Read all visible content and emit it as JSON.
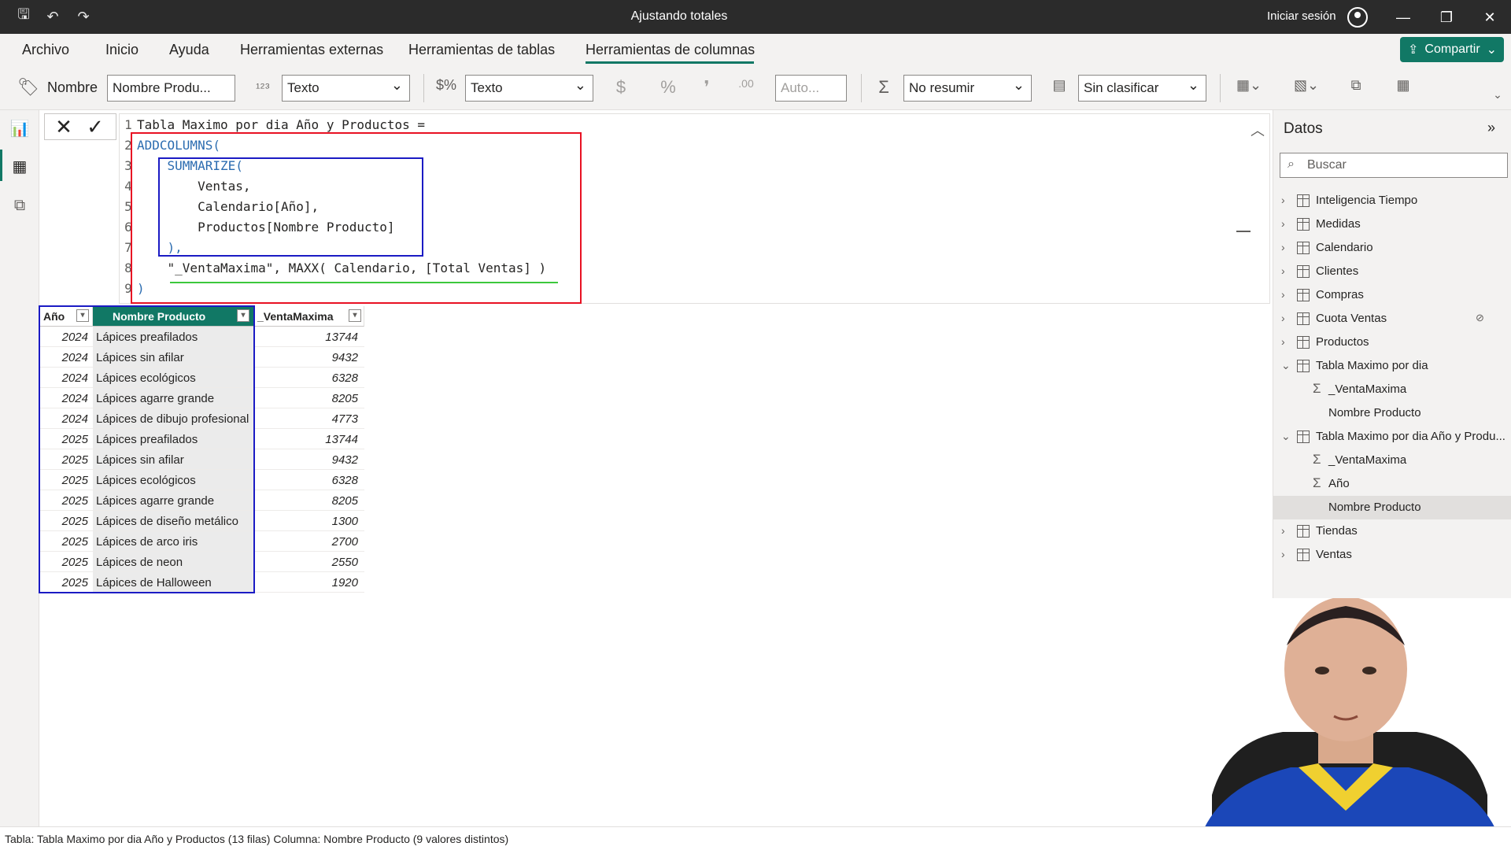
{
  "window": {
    "title": "Ajustando totales",
    "signin": "Iniciar sesión"
  },
  "menu": {
    "tabs": [
      "Archivo",
      "Inicio",
      "Ayuda",
      "Herramientas externas",
      "Herramientas de tablas",
      "Herramientas de columnas"
    ],
    "share": "Compartir"
  },
  "ribbon": {
    "name_label": "Nombre",
    "name_value": "Nombre Produ...",
    "datatype_value": "Texto",
    "format_value": "Texto",
    "decimals_placeholder": "Auto...",
    "summarize_value": "No resumir",
    "category_value": "Sin clasificar"
  },
  "formula": {
    "lines": [
      "Tabla Maximo por dia Año y Productos =",
      "ADDCOLUMNS(",
      "    SUMMARIZE(",
      "        Ventas,",
      "        Calendario[Año],",
      "        Productos[Nombre Producto]",
      "    ),",
      "    \"_VentaMaxima\", MAXX( Calendario, [Total Ventas] )",
      ")"
    ]
  },
  "grid": {
    "columns": [
      "Año",
      "Nombre Producto",
      "_VentaMaxima"
    ],
    "rows": [
      [
        "2024",
        "Lápices preafilados",
        "13744"
      ],
      [
        "2024",
        "Lápices sin afilar",
        "9432"
      ],
      [
        "2024",
        "Lápices ecológicos",
        "6328"
      ],
      [
        "2024",
        "Lápices agarre grande",
        "8205"
      ],
      [
        "2024",
        "Lápices de dibujo profesional",
        "4773"
      ],
      [
        "2025",
        "Lápices preafilados",
        "13744"
      ],
      [
        "2025",
        "Lápices sin afilar",
        "9432"
      ],
      [
        "2025",
        "Lápices ecológicos",
        "6328"
      ],
      [
        "2025",
        "Lápices agarre grande",
        "8205"
      ],
      [
        "2025",
        "Lápices de diseño metálico",
        "1300"
      ],
      [
        "2025",
        "Lápices de arco iris",
        "2700"
      ],
      [
        "2025",
        "Lápices de neon",
        "2550"
      ],
      [
        "2025",
        "Lápices de Halloween",
        "1920"
      ]
    ]
  },
  "datos": {
    "title": "Datos",
    "search_placeholder": "Buscar",
    "items": [
      {
        "label": "Inteligencia Tiempo",
        "type": "table",
        "expanded": false
      },
      {
        "label": "Medidas",
        "type": "table",
        "expanded": false
      },
      {
        "label": "Calendario",
        "type": "table",
        "expanded": false
      },
      {
        "label": "Clientes",
        "type": "table",
        "expanded": false
      },
      {
        "label": "Compras",
        "type": "table",
        "expanded": false
      },
      {
        "label": "Cuota Ventas",
        "type": "table",
        "expanded": false
      },
      {
        "label": "Productos",
        "type": "table",
        "expanded": false
      },
      {
        "label": "Tabla Maximo por dia",
        "type": "table",
        "expanded": true
      },
      {
        "label": "_VentaMaxima",
        "type": "sum-column"
      },
      {
        "label": "Nombre Producto",
        "type": "column"
      },
      {
        "label": "Tabla Maximo por dia Año y Produ...",
        "type": "table",
        "expanded": true
      },
      {
        "label": "_VentaMaxima",
        "type": "sum-column"
      },
      {
        "label": "Año",
        "type": "sum-column"
      },
      {
        "label": "Nombre Producto",
        "type": "column",
        "selected": true
      },
      {
        "label": "Tiendas",
        "type": "table",
        "expanded": false
      },
      {
        "label": "Ventas",
        "type": "table",
        "expanded": false
      }
    ]
  },
  "status": {
    "text": "Tabla: Tabla Maximo por dia Año y Productos (13 filas) Columna: Nombre Producto (9 valores distintos)"
  },
  "colors": {
    "accent": "#117865",
    "highlight_red": "#e81123",
    "highlight_blue": "#1b1bc4",
    "highlight_green": "#3cc83c"
  }
}
